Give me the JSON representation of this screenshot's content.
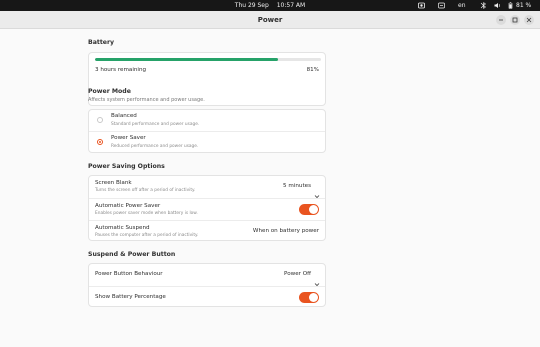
{
  "topbar": {
    "date": "Thu 29 Sep",
    "time": "10:57 AM",
    "lang": "en",
    "battery_pct": "81 %"
  },
  "window": {
    "title": "Power"
  },
  "battery": {
    "section_title": "Battery",
    "remaining": "3 hours remaining",
    "percent": "81%",
    "level": 0.81,
    "bar_color": "#26a269"
  },
  "power_mode": {
    "section_title": "Power Mode",
    "subtitle": "Affects system performance and power usage.",
    "options": [
      {
        "label": "Balanced",
        "sub": "Standard performance and power usage.",
        "selected": false
      },
      {
        "label": "Power Saver",
        "sub": "Reduced performance and power usage.",
        "selected": true
      }
    ]
  },
  "saving": {
    "section_title": "Power Saving Options",
    "screen_blank_label": "Screen Blank",
    "screen_blank_sub": "Turns the screen off after a period of inactivity.",
    "screen_blank_value": "5 minutes",
    "auto_saver_label": "Automatic Power Saver",
    "auto_saver_sub": "Enables power saver mode when battery is low.",
    "auto_saver_on": true,
    "auto_suspend_label": "Automatic Suspend",
    "auto_suspend_sub": "Pauses the computer after a period of inactivity.",
    "auto_suspend_value": "When on battery power"
  },
  "suspend": {
    "section_title": "Suspend & Power Button",
    "button_label": "Power Button Behaviour",
    "button_value": "Power Off",
    "show_pct_label": "Show Battery Percentage",
    "show_pct_on": true
  },
  "colors": {
    "accent": "#e95420",
    "topbar": "#171717"
  }
}
